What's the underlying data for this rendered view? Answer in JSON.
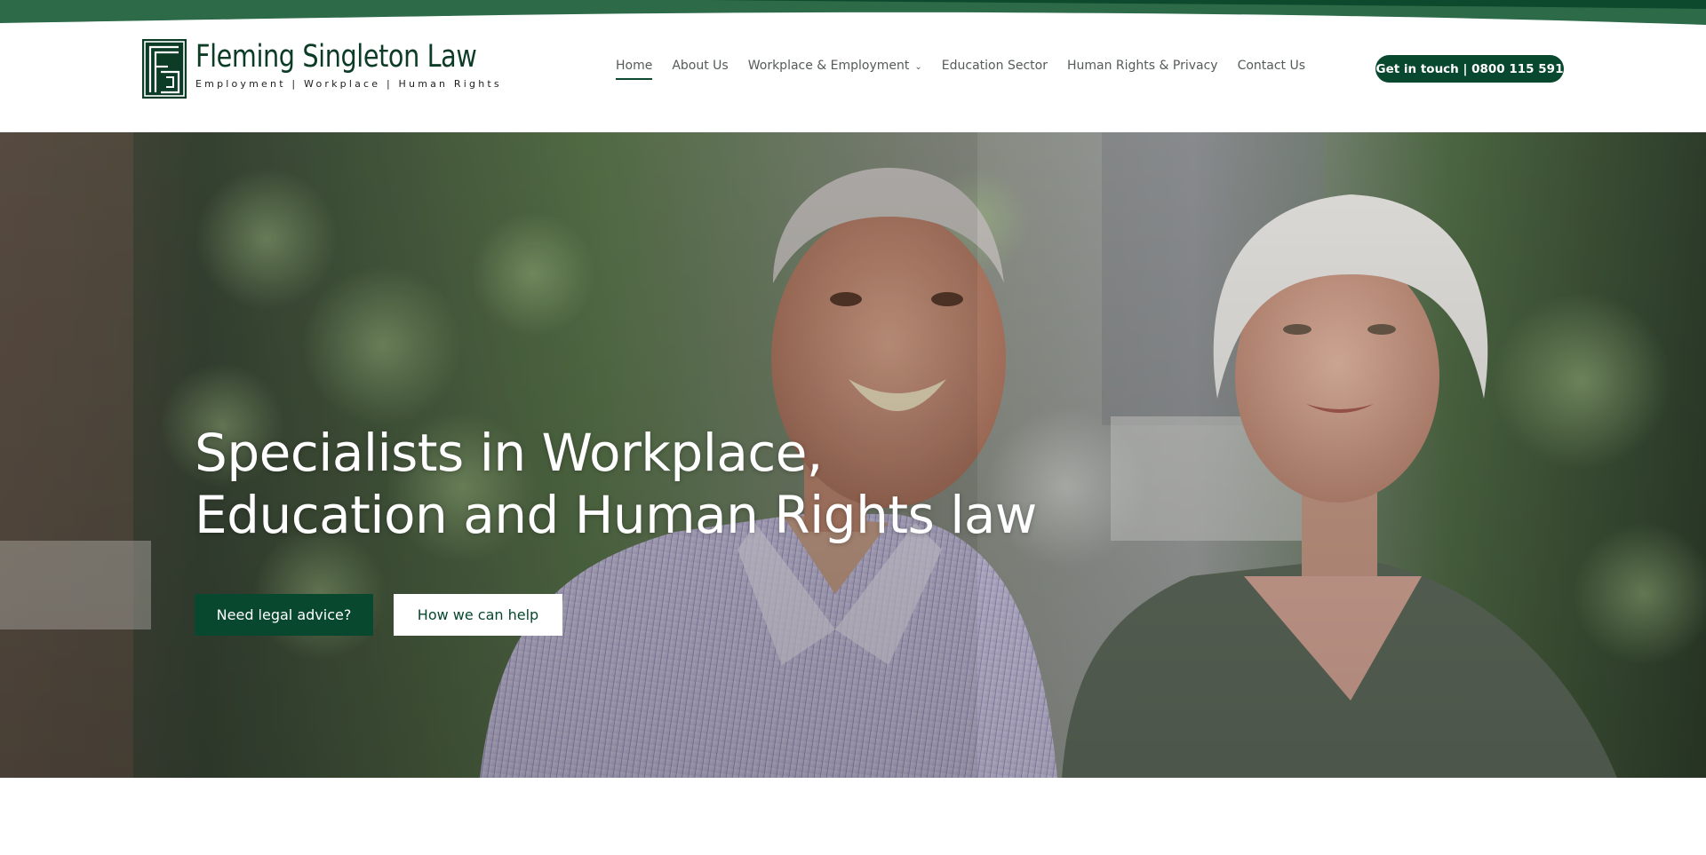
{
  "brand": {
    "name": "Fleming Singleton Law",
    "tagline": "Employment | Workplace | Human Rights",
    "logo_mark": "FS monogram",
    "color_primary": "#07482f",
    "color_dark": "#0c3b26"
  },
  "nav": {
    "items": [
      {
        "label": "Home",
        "active": true
      },
      {
        "label": "About Us",
        "active": false
      },
      {
        "label": "Workplace & Employment",
        "active": false,
        "has_dropdown": true
      },
      {
        "label": "Education Sector",
        "active": false
      },
      {
        "label": "Human Rights & Privacy",
        "active": false
      },
      {
        "label": "Contact Us",
        "active": false
      }
    ],
    "dropdown_icon": "chevron-down-icon"
  },
  "header_cta": {
    "label": "Get in touch | 0800 115 591"
  },
  "hero": {
    "title_line1": "Specialists in Workplace,",
    "title_line2": "Education and Human Rights law",
    "primary_button": "Need legal advice?",
    "secondary_button": "How we can help",
    "image_subject": "photo of a smiling man in a striped shirt and a woman in a green top"
  }
}
